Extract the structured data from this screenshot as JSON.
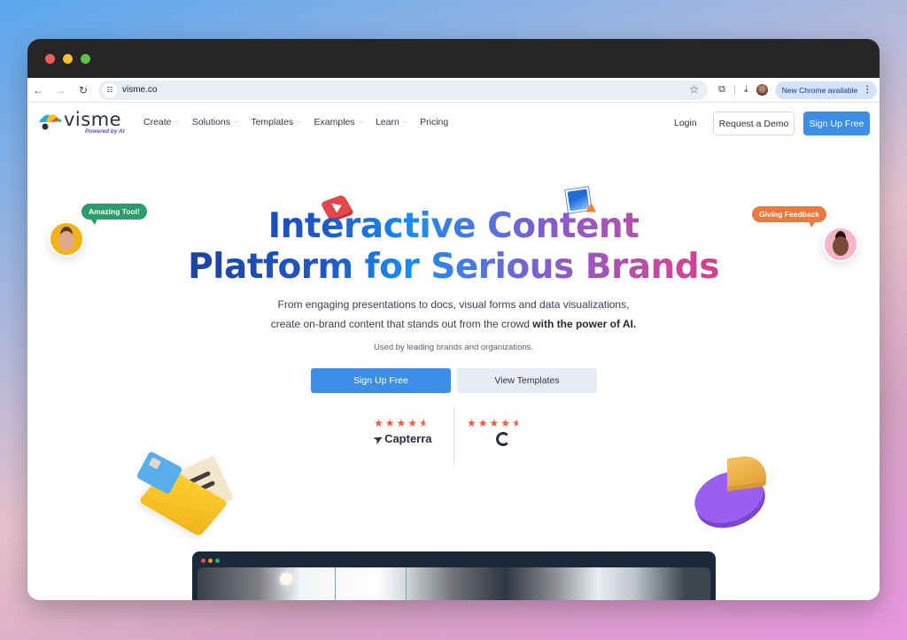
{
  "browser": {
    "url": "visme.co",
    "update_label": "New Chrome available",
    "icons": {
      "back": "arrow-left-icon",
      "forward": "arrow-right-icon",
      "reload": "reload-icon",
      "site_info": "tune-icon",
      "bookmark": "star-icon",
      "extensions": "puzzle-icon",
      "download": "download-icon",
      "menu": "kebab-icon"
    }
  },
  "nav": {
    "logo_word": "visme",
    "logo_sub": "Powered by AI",
    "items": [
      {
        "label": "Create",
        "has_dropdown": true
      },
      {
        "label": "Solutions",
        "has_dropdown": true
      },
      {
        "label": "Templates",
        "has_dropdown": true
      },
      {
        "label": "Examples",
        "has_dropdown": true
      },
      {
        "label": "Learn",
        "has_dropdown": true
      },
      {
        "label": "Pricing",
        "has_dropdown": false
      }
    ],
    "login": "Login",
    "demo": "Request a Demo",
    "signup": "Sign Up Free"
  },
  "hero": {
    "title_line1": "Interactive Content",
    "title_line2": "Platform for Serious Brands",
    "subtitle_line1": "From engaging presentations to docs, visual forms and data visualizations,",
    "subtitle_line2_plain": "create on-brand content that stands out from the crowd ",
    "subtitle_line2_bold": "with the power of AI.",
    "used_by": "Used by leading brands and organizations.",
    "cta_primary": "Sign Up Free",
    "cta_secondary": "View Templates"
  },
  "ratings": [
    {
      "source": "Capterra",
      "stars_full": "★★★★",
      "stars_half": "★",
      "rating": 4.5
    },
    {
      "source": "G2",
      "stars_full": "★★★★",
      "stars_half": "★",
      "rating": 4.5
    }
  ],
  "testimonials": {
    "left_bubble": "Amazing Tool!",
    "right_bubble": "Giving Feedback"
  },
  "colors": {
    "primary": "#3c8fe5",
    "rating_star": "#ef5a3c",
    "bubble_green": "#2a9d6c",
    "bubble_orange": "#ec7a3e"
  },
  "floating": {
    "help": "?",
    "cookie": "cookie-icon"
  }
}
